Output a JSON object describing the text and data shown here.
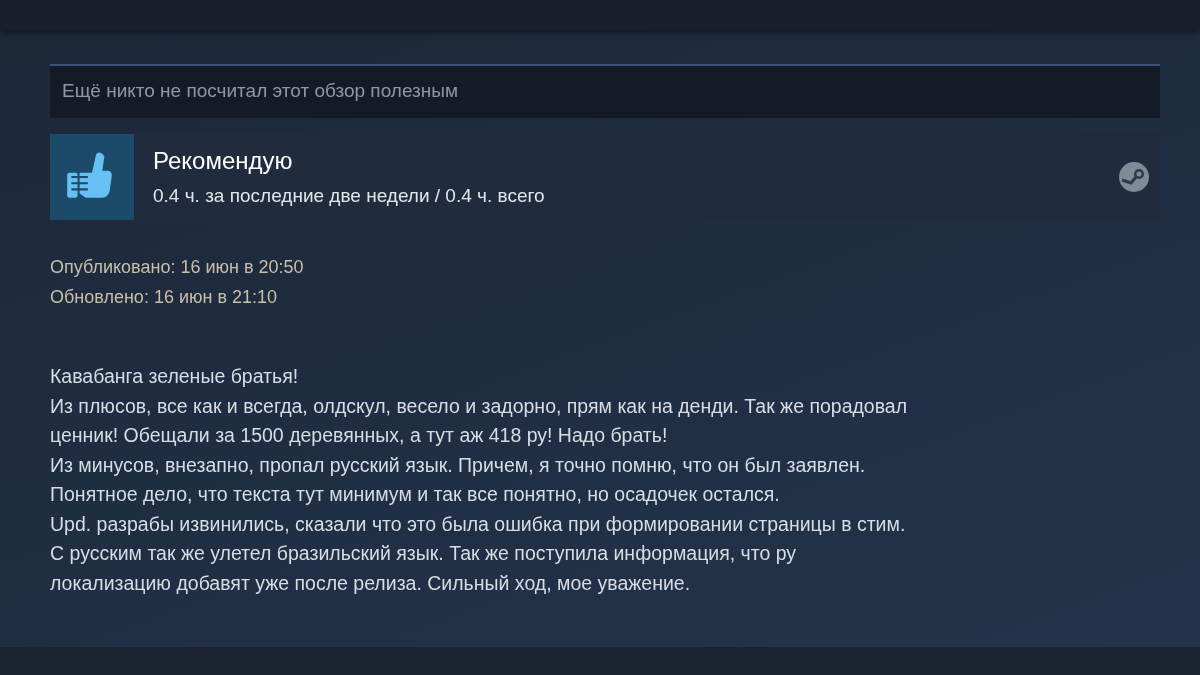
{
  "helpful_bar": {
    "text": "Ещё никто не посчитал этот обзор полезным"
  },
  "recommendation": {
    "verdict": "Рекомендую",
    "kind": "positive",
    "hours": "0.4 ч. за последние две недели / 0.4 ч. всего"
  },
  "dates": [
    "Опубликовано: 16 июн в 20:50",
    "Обновлено: 16 июн в 21:10"
  ],
  "review_lines": [
    "Кавабанга зеленые братья!",
    "Из плюсов, все как и всегда, олдскул, весело и задорно, прям как на денди. Так же порадовал",
    "ценник! Обещали за 1500 деревянных, а тут аж 418 ру! Надо брать!",
    "Из минусов, внезапно, пропал русский язык. Причем, я точно помню, что он был заявлен.",
    "Понятное дело, что текста тут минимум и так все понятно, но осадочек остался.",
    "Upd. разрабы извинились, сказали что это была ошибка при формировании страницы в стим.",
    "С русским так же улетел бразильский язык. Так же поступила информация, что ру",
    "локализацию добавят уже после релиза. Сильный ход, мое уважение."
  ]
}
